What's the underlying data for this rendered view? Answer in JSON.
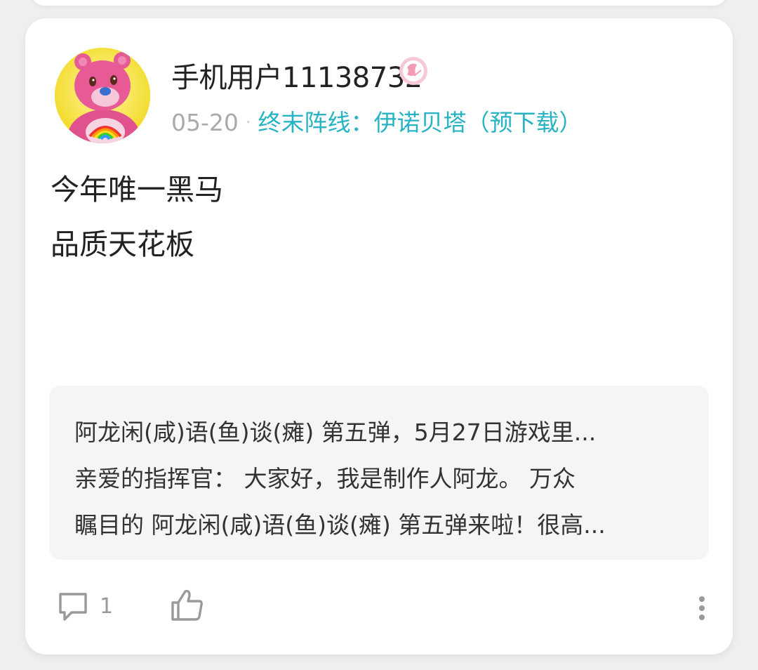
{
  "post": {
    "username": "手机用户11138732",
    "date": "05-20",
    "separator": "·",
    "game": "终末阵线：伊诺贝塔（预下载）",
    "content_lines": [
      "今年唯一黑马",
      "品质天花板"
    ],
    "avatar_icon": "pink-bear-avatar",
    "badge_icon": "anniversary-badge-icon",
    "accent_color": "#27b3c4",
    "badge_color": "#f29bb4"
  },
  "quote": {
    "lines": [
      "阿龙闲(咸)语(鱼)谈(瘫) 第五弹，5月27日游戏里...",
      "亲爱的指挥官： 大家好，我是制作人阿龙。 万众",
      "瞩目的 阿龙闲(咸)语(鱼)谈(瘫) 第五弹来啦！很高..."
    ]
  },
  "actions": {
    "comment_icon": "comment-icon",
    "comment_count": "1",
    "like_icon": "thumbs-up-icon",
    "more_icon": "more-vertical-icon"
  }
}
